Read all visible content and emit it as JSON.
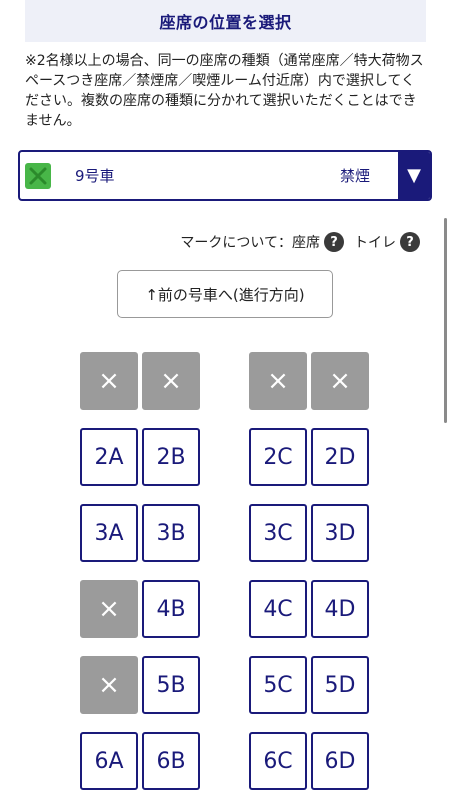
{
  "header": {
    "title": "座席の位置を選択"
  },
  "notice": "※2名様以上の場合、同一の座席の種類（通常座席／特大荷物スペースつき座席／禁煙席／喫煙ルーム付近席）内で選択してください。複数の座席の種類に分かれて選択いただくことはできません。",
  "car_select": {
    "car": "9号車",
    "smoking": "禁煙",
    "dropdown_icon": "▼",
    "icon": "green-x-icon"
  },
  "legend": {
    "label": "マークについて：座席",
    "help": "?",
    "toilet": "トイレ"
  },
  "prev_car_button": "↑前の号車へ(進行方向)",
  "seats": {
    "taken_mark": "×",
    "r1": {
      "a": "",
      "b": "",
      "c": "",
      "d": ""
    },
    "r2": {
      "a": "2A",
      "b": "2B",
      "c": "2C",
      "d": "2D"
    },
    "r3": {
      "a": "3A",
      "b": "3B",
      "c": "3C",
      "d": "3D"
    },
    "r4": {
      "a": "",
      "b": "4B",
      "c": "4C",
      "d": "4D"
    },
    "r5": {
      "a": "",
      "b": "5B",
      "c": "5C",
      "d": "5D"
    },
    "r6": {
      "a": "6A",
      "b": "6B",
      "c": "6C",
      "d": "6D"
    }
  },
  "colors": {
    "accent": "#1a1a7a",
    "taken": "#9b9b9b",
    "icon_green": "#48b648"
  }
}
